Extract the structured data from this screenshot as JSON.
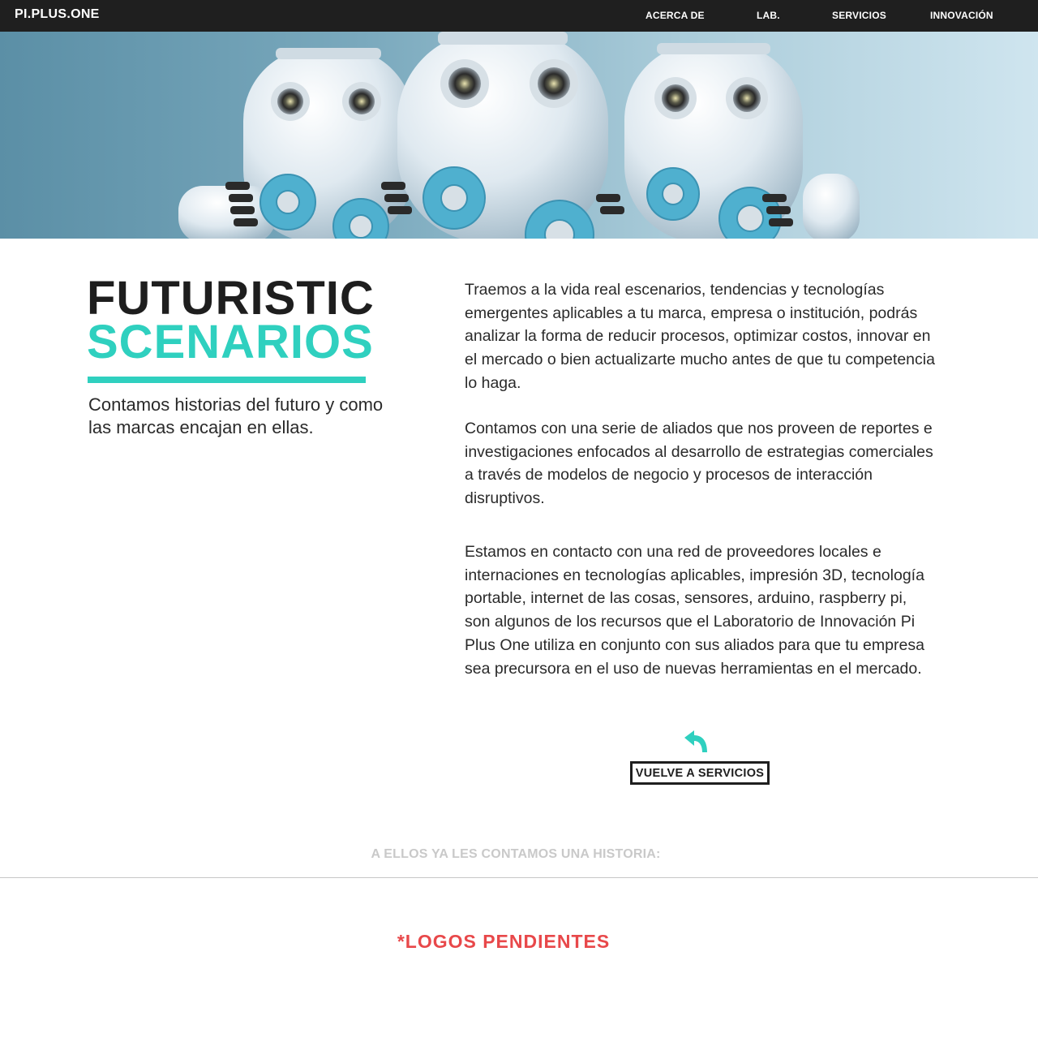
{
  "nav": {
    "brand": "PI.PLUS.ONE",
    "items": [
      {
        "label": "ACERCA DE"
      },
      {
        "label": "LAB."
      },
      {
        "label": "SERVICIOS"
      },
      {
        "label": "INNOVACIÓN"
      }
    ]
  },
  "hero": {
    "image": "robots-with-gears",
    "accent_color": "#2fd0bf"
  },
  "intro": {
    "title_line1": "FUTURISTIC",
    "title_line2": "SCENARIOS",
    "tagline": "Contamos historias del futuro y como las marcas encajan en ellas.",
    "title_color": "#1e1e1e",
    "accent_color": "#2fd0bf"
  },
  "body": {
    "paragraphs": [
      "Traemos a la vida real escenarios, tendencias y tecnologías emergentes aplicables a tu marca, empresa o institución, podrás analizar la forma de reducir procesos, optimizar costos, innovar en el mercado o bien actualizarte mucho antes de que tu competencia lo haga.",
      "Contamos con una serie de aliados que nos proveen de reportes e investigaciones enfocados al desarrollo de estrategias comerciales a través de modelos de negocio y procesos de interacción disruptivos.",
      "Estamos en contacto con una red de proveedores locales e internaciones en tecnologías aplicables, impresión 3D, tecnología portable, internet de las cosas, sensores, arduino, raspberry pi, son algunos de los recursos que el Laboratorio de Innovación Pi Plus One utiliza en conjunto con sus aliados para que tu empresa sea precursora en el uso de nuevas herramientas en el mercado."
    ]
  },
  "back": {
    "icon": "return-arrow-icon",
    "label": "VUELVE A SERVICIOS"
  },
  "clients": {
    "heading": "A ELLOS YA LES CONTAMOS UNA HISTORIA:",
    "pending_note": "*LOGOS PENDIENTES",
    "pending_color": "#e8484a"
  }
}
